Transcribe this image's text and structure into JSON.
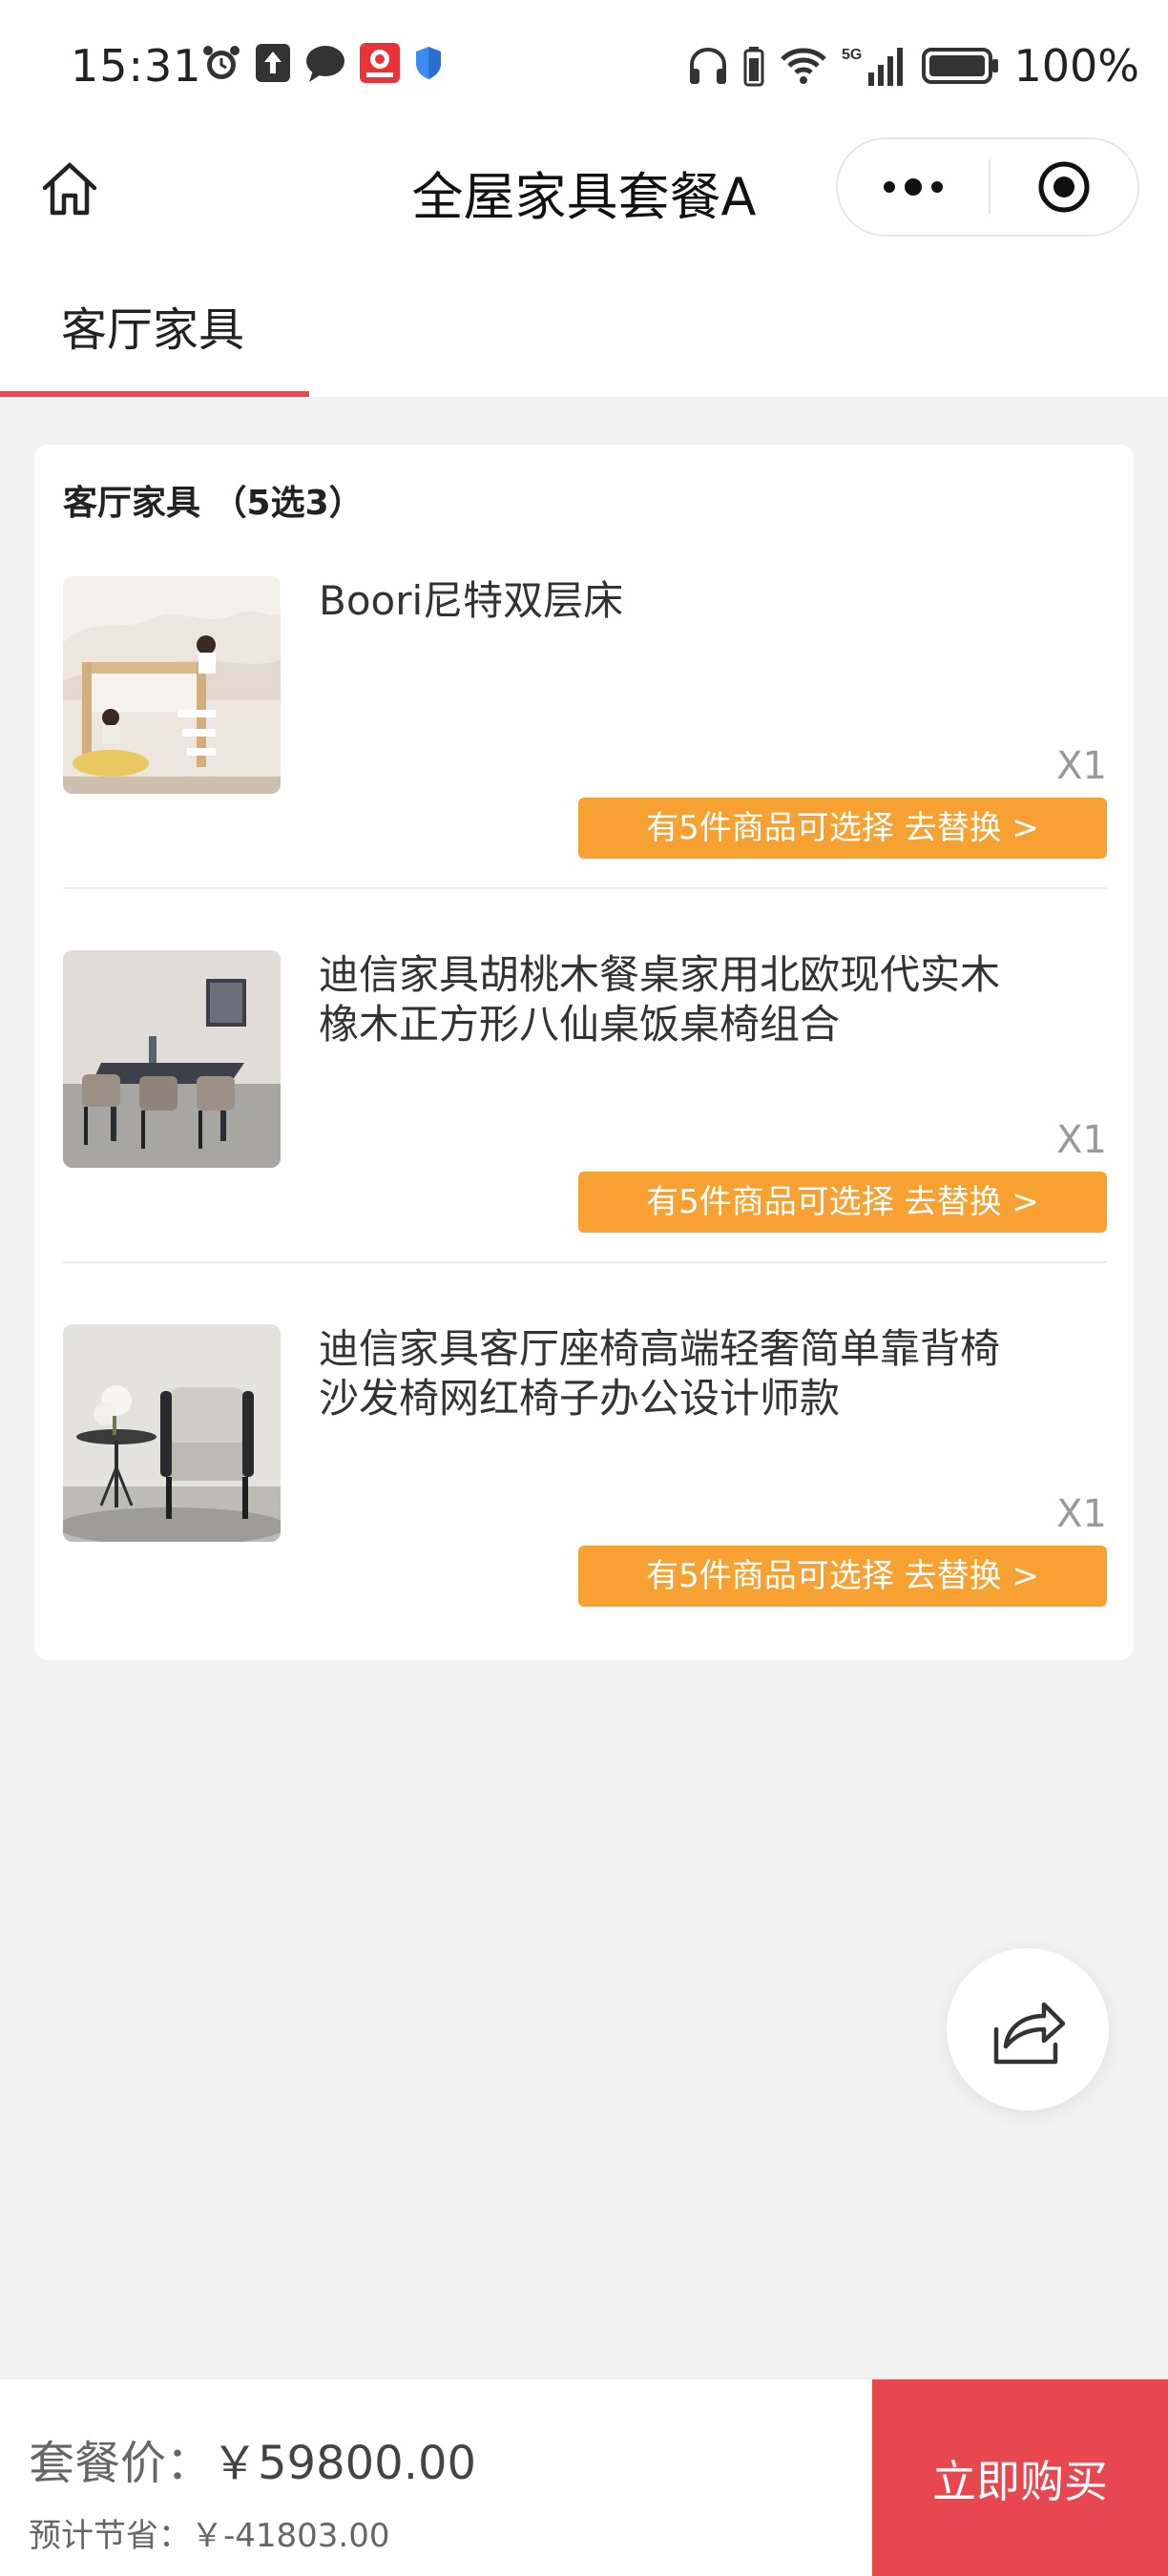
{
  "status_bar": {
    "time": "15:31",
    "battery_percent": "100%",
    "network": "5G"
  },
  "nav": {
    "title": "全屋家具套餐A"
  },
  "tabs": [
    {
      "label": "客厅家具",
      "active": true
    }
  ],
  "section": {
    "title": "客厅家具 （5选3）",
    "items": [
      {
        "name": "Boori尼特双层床",
        "qty": "X1",
        "swap_label": "有5件商品可选择 去替换 >"
      },
      {
        "name": "迪信家具胡桃木餐桌家用北欧现代实木橡木正方形八仙桌饭桌椅组合",
        "qty": "X1",
        "swap_label": "有5件商品可选择 去替换 >"
      },
      {
        "name": "迪信家具客厅座椅高端轻奢简单靠背椅沙发椅网红椅子办公设计师款",
        "qty": "X1",
        "swap_label": "有5件商品可选择 去替换 >"
      }
    ]
  },
  "bottom": {
    "price_label": "套餐价：",
    "price_value": "￥59800.00",
    "save_label": "预计节省：",
    "save_value": "￥-41803.00",
    "buy_label": "立即购买"
  },
  "colors": {
    "accent_red": "#e8474f",
    "swap_orange": "#f6a131",
    "tab_underline": "#e84a55"
  }
}
